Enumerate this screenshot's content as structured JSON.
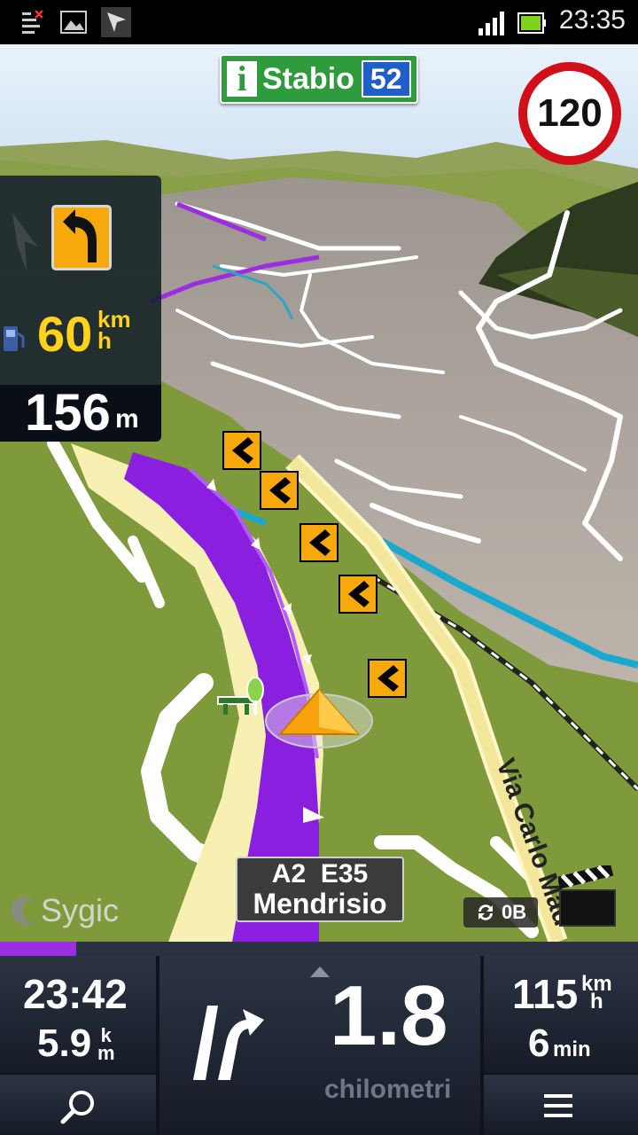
{
  "status_bar": {
    "time": "23:35",
    "icons": [
      "notification-icon",
      "gallery-icon",
      "navigation-arrow-icon",
      "signal-icon",
      "battery-icon"
    ]
  },
  "top_sign": {
    "name": "Stabio",
    "number": "52",
    "info_glyph": "i"
  },
  "speed_limit": "120",
  "left_panel": {
    "current_speed": "60",
    "speed_unit_top": "km",
    "speed_unit_bottom": "h",
    "next_turn_distance": "156",
    "next_turn_distance_unit": "m",
    "icons": [
      "turn-left-icon",
      "fuel-icon"
    ]
  },
  "road_sign": {
    "line1": "A2  E35",
    "line2": "Mendrisio"
  },
  "street_label": "Via Carlo Mad",
  "brand": "Sygic",
  "data_counter": "0B",
  "route_progress": 0.12,
  "bottom_bar": {
    "eta_time": "23:42",
    "remaining_distance": "5.9",
    "remaining_distance_unit_top": "k",
    "remaining_distance_unit_bottom": "m",
    "next_maneuver_distance": "1.8",
    "next_maneuver_unit": "chilometri",
    "speed": "115",
    "speed_unit_top": "km",
    "speed_unit_bottom": "h",
    "remaining_time": "6",
    "remaining_time_unit": "min"
  },
  "colors": {
    "route": "#8a1fe0",
    "terrain": "#7f9a3a",
    "sign_green": "#2e9b3c",
    "sign_blue": "#1f5fc7",
    "speed_limit_red": "#d10f1a",
    "turn_orange": "#f7a90c",
    "current_speed_yellow": "#ffd21c"
  }
}
